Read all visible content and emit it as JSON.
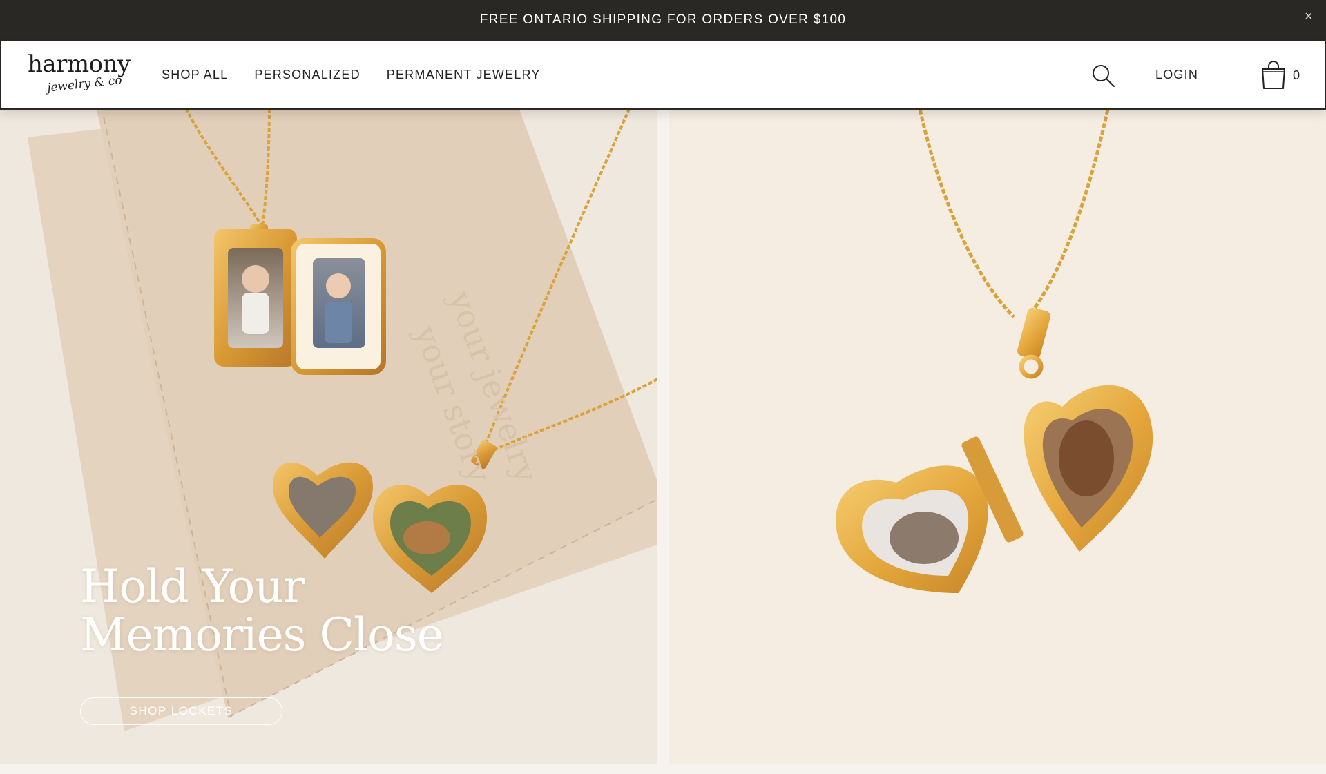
{
  "announcement": {
    "text": "FREE ONTARIO SHIPPING FOR ORDERS OVER $100",
    "close_icon": "close-icon",
    "close_glyph": "×"
  },
  "header": {
    "logo": {
      "main": "harmony",
      "sub": "jewelry & co"
    },
    "nav": [
      {
        "label": "SHOP ALL"
      },
      {
        "label": "PERSONALIZED"
      },
      {
        "label": "PERMANENT JEWELRY"
      }
    ],
    "search_icon": "search-icon",
    "login_label": "LOGIN",
    "cart_icon": "shopping-bag-icon",
    "cart_count": "0"
  },
  "hero": {
    "title_line1": "Hold Your",
    "title_line2": "Memories Close",
    "cta_label": "SHOP LOCKETS",
    "pouch_emboss_1": "your jewelry",
    "pouch_emboss_2": "your story"
  },
  "colors": {
    "announcement_bg": "#2a2825",
    "header_bg": "#ffffff",
    "gold": "#d9a33b",
    "left_bg": "#e9e0d4",
    "right_bg": "#f5ede2"
  }
}
